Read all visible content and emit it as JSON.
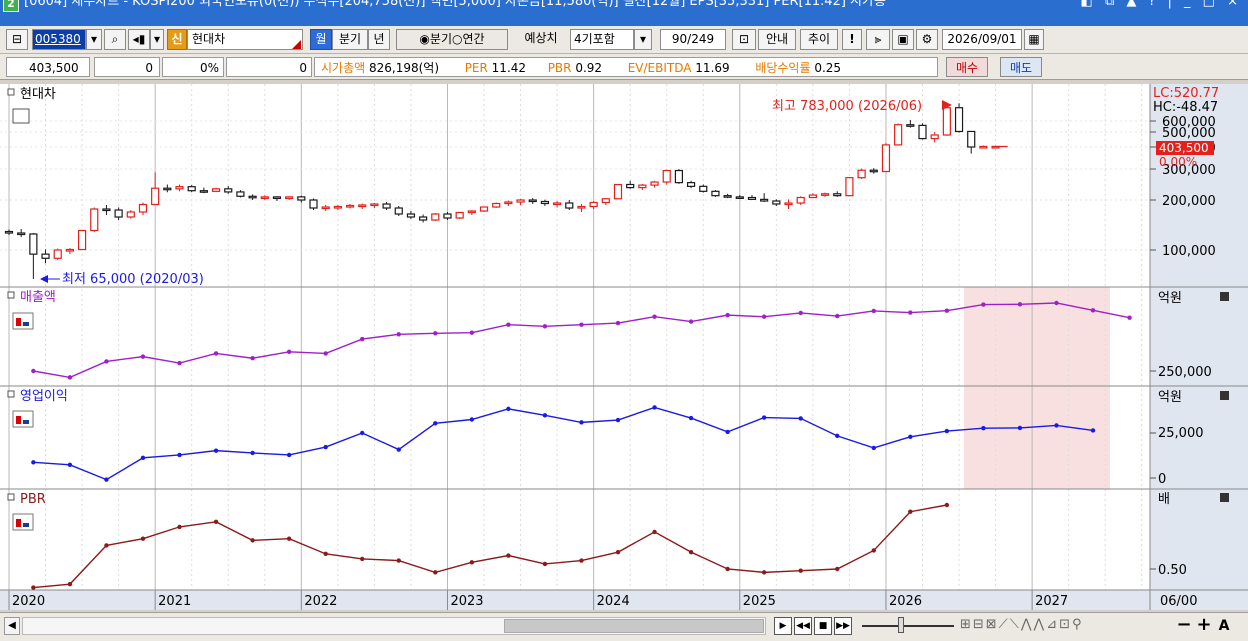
{
  "window": {
    "title": "[0604] 재무차트 - KOSPI200 외국인보유(0(천)) 주식수[204,758(천)] 액면[5,000] 자본금[11,580(억)] 결산[12월] EPS[35,331] PER[11.42] 시가총",
    "icon_label": "2",
    "controls": "◧ ⧉ ▲ ? | _ □ ×"
  },
  "toolbar": {
    "code": "005380",
    "new_badge": "신",
    "stock_name": "현대차",
    "period_month": "월",
    "period_quarter": "분기",
    "period_year": "년",
    "radio_quarter": "분기",
    "radio_annual": "연간",
    "estimate_label": "예상치",
    "estimate_select": "4기포함",
    "page_counter": "90/249",
    "guide_label": "안내",
    "trend_label": "추이",
    "exclaim_label": "!",
    "date_value": "2026/09/01"
  },
  "infobar": {
    "price": "403,500",
    "change": "0",
    "change_pct": "0%",
    "volume": "0",
    "mktcap_label": "시가총액",
    "mktcap_value": "826,198(억)",
    "per_label": "PER",
    "per_value": "11.42",
    "pbr_label": "PBR",
    "pbr_value": "0.92",
    "ev_label": "EV/EBITDA",
    "ev_value": "11.69",
    "div_label": "배당수익률",
    "div_value": "0.25",
    "buy_label": "매수",
    "sell_label": "매도"
  },
  "colors": {
    "up": "#e3201b",
    "down": "#1a1a1a",
    "sales_line": "#a020c8",
    "op_line": "#1a1ae6",
    "pbr_line": "#8b1a1a",
    "forecast_shade": "#f8e0e0",
    "axis_bg": "#dfe6f0",
    "price_tag": "#e3201b"
  },
  "panels": {
    "price": {
      "title": "현대차",
      "lc_label": "LC:520.77",
      "hc_label": "HC:-48.47",
      "high_annotation": "최고 783,000 (2026/06)",
      "low_annotation": "최저 65,000 (2020/03)",
      "current_tag": "403,500",
      "current_pct": "0.00%",
      "y_ticks": [
        "600,000",
        "500,000",
        "400,000",
        "300,000",
        "200,000",
        "100,000"
      ]
    },
    "sales": {
      "title": "매출액",
      "unit": "억원",
      "y_tick": "250,000"
    },
    "op": {
      "title": "영업이익",
      "unit": "억원",
      "y_ticks": [
        "25,000",
        "0"
      ]
    },
    "pbr": {
      "title": "PBR",
      "unit": "배",
      "y_tick": "0.50"
    }
  },
  "x_axis": {
    "labels": [
      "2020",
      "2021",
      "2022",
      "2023",
      "2024",
      "2025",
      "2026",
      "2027"
    ],
    "right_label": "06/00"
  },
  "chart_data": [
    {
      "type": "candlestick",
      "title": "현대차",
      "unit": "원",
      "start": "2020/01",
      "frequency": "monthly",
      "ylim": [
        0,
        800000
      ],
      "candles": [
        [
          137000,
          141000,
          130000,
          134000
        ],
        [
          134000,
          142000,
          126000,
          132000
        ],
        [
          132000,
          134000,
          65000,
          95000
        ],
        [
          95000,
          101000,
          84000,
          90000
        ],
        [
          90000,
          103000,
          88000,
          100000
        ],
        [
          100000,
          104000,
          95000,
          101000
        ],
        [
          101000,
          140000,
          100000,
          139000
        ],
        [
          139000,
          185000,
          136000,
          182000
        ],
        [
          182000,
          190000,
          170000,
          180000
        ],
        [
          180000,
          185000,
          160000,
          166000
        ],
        [
          166000,
          180000,
          163000,
          176000
        ],
        [
          176000,
          195000,
          170000,
          191000
        ],
        [
          191000,
          289000,
          212000,
          238000
        ],
        [
          238000,
          250000,
          225000,
          236000
        ],
        [
          236000,
          250000,
          228000,
          243000
        ],
        [
          243000,
          248000,
          225000,
          230000
        ],
        [
          230000,
          240000,
          222000,
          228000
        ],
        [
          228000,
          240000,
          225000,
          236000
        ],
        [
          236000,
          245000,
          220000,
          226000
        ],
        [
          226000,
          232000,
          208000,
          212000
        ],
        [
          212000,
          218000,
          200000,
          208000
        ],
        [
          208000,
          215000,
          200000,
          210000
        ],
        [
          210000,
          212000,
          198000,
          205000
        ],
        [
          205000,
          212000,
          200000,
          210000
        ],
        [
          210000,
          214000,
          195000,
          200000
        ],
        [
          200000,
          205000,
          180000,
          184000
        ],
        [
          184000,
          190000,
          178000,
          186000
        ],
        [
          186000,
          190000,
          180000,
          187000
        ],
        [
          187000,
          192000,
          183000,
          189000
        ],
        [
          189000,
          193000,
          182000,
          190000
        ],
        [
          190000,
          194000,
          184000,
          192000
        ],
        [
          192000,
          196000,
          180000,
          184000
        ],
        [
          184000,
          188000,
          168000,
          172000
        ],
        [
          172000,
          178000,
          162000,
          166000
        ],
        [
          166000,
          171000,
          155000,
          160000
        ],
        [
          160000,
          174000,
          158000,
          172000
        ],
        [
          172000,
          176000,
          160000,
          164000
        ],
        [
          164000,
          176000,
          162000,
          175000
        ],
        [
          175000,
          180000,
          170000,
          178000
        ],
        [
          178000,
          187000,
          176000,
          186000
        ],
        [
          186000,
          195000,
          184000,
          193000
        ],
        [
          193000,
          199000,
          188000,
          196000
        ],
        [
          196000,
          204000,
          190000,
          200000
        ],
        [
          200000,
          206000,
          192000,
          197000
        ],
        [
          197000,
          201000,
          188000,
          193000
        ],
        [
          193000,
          198000,
          185000,
          194000
        ],
        [
          194000,
          200000,
          180000,
          184000
        ],
        [
          184000,
          192000,
          176000,
          187000
        ],
        [
          187000,
          198000,
          182000,
          195000
        ],
        [
          195000,
          206000,
          190000,
          204000
        ],
        [
          204000,
          251000,
          202000,
          250000
        ],
        [
          250000,
          262000,
          236000,
          240000
        ],
        [
          240000,
          252000,
          232000,
          248000
        ],
        [
          248000,
          262000,
          240000,
          258000
        ],
        [
          258000,
          298000,
          250000,
          295000
        ],
        [
          295000,
          300000,
          252000,
          256000
        ],
        [
          256000,
          262000,
          238000,
          244000
        ],
        [
          244000,
          250000,
          224000,
          228000
        ],
        [
          228000,
          232000,
          210000,
          214000
        ],
        [
          214000,
          220000,
          206000,
          210000
        ],
        [
          210000,
          216000,
          204000,
          208000
        ],
        [
          208000,
          216000,
          200000,
          202000
        ],
        [
          202000,
          222000,
          196000,
          198000
        ],
        [
          198000,
          202000,
          188000,
          192000
        ],
        [
          192000,
          202000,
          182000,
          194000
        ],
        [
          194000,
          212000,
          190000,
          208000
        ],
        [
          208000,
          222000,
          206000,
          216000
        ],
        [
          216000,
          224000,
          210000,
          220000
        ],
        [
          220000,
          228000,
          210000,
          214000
        ],
        [
          214000,
          274000,
          212000,
          272000
        ],
        [
          272000,
          302000,
          268000,
          296000
        ],
        [
          296000,
          304000,
          285000,
          292000
        ],
        [
          292000,
          428000,
          290000,
          414000
        ],
        [
          414000,
          578000,
          410000,
          566000
        ],
        [
          566000,
          610000,
          540000,
          560000
        ],
        [
          560000,
          580000,
          450000,
          456000
        ],
        [
          456000,
          500000,
          430000,
          480000
        ],
        [
          480000,
          783000,
          475000,
          735000
        ],
        [
          735000,
          780000,
          495000,
          505000
        ],
        [
          505000,
          505000,
          370000,
          400000
        ],
        [
          400000,
          410000,
          395000,
          403500
        ],
        [
          403500,
          403500,
          403500,
          403500
        ]
      ]
    },
    {
      "type": "line",
      "title": "매출액",
      "unit": "억원",
      "x_start": "2020/03",
      "x_step_months": 3,
      "values": [
        250000,
        230000,
        280000,
        295000,
        275000,
        305000,
        290000,
        310000,
        305000,
        350000,
        365000,
        368000,
        370000,
        395000,
        390000,
        395000,
        400000,
        420000,
        405000,
        425000,
        420000,
        432000,
        422000,
        438000,
        433000,
        439000,
        458000,
        459000,
        463000,
        440000,
        417000
      ]
    },
    {
      "type": "line",
      "title": "영업이익",
      "unit": "억원",
      "x_start": "2020/03",
      "x_step_months": 3,
      "values": [
        8700,
        7300,
        -900,
        11200,
        12800,
        15200,
        13900,
        12800,
        17200,
        25000,
        15800,
        30400,
        32500,
        38400,
        34800,
        30900,
        32200,
        39200,
        33300,
        25600,
        33600,
        33100,
        23400,
        16700,
        22900,
        26100,
        27700,
        27800,
        29200,
        26400
      ]
    },
    {
      "type": "line",
      "title": "PBR",
      "unit": "배",
      "x_start": "2020/03",
      "x_step_months": 3,
      "values": [
        0.39,
        0.41,
        0.64,
        0.68,
        0.75,
        0.78,
        0.67,
        0.68,
        0.59,
        0.56,
        0.55,
        0.48,
        0.54,
        0.58,
        0.53,
        0.55,
        0.6,
        0.72,
        0.6,
        0.5,
        0.48,
        0.49,
        0.5,
        0.61,
        0.84,
        0.88
      ]
    }
  ]
}
